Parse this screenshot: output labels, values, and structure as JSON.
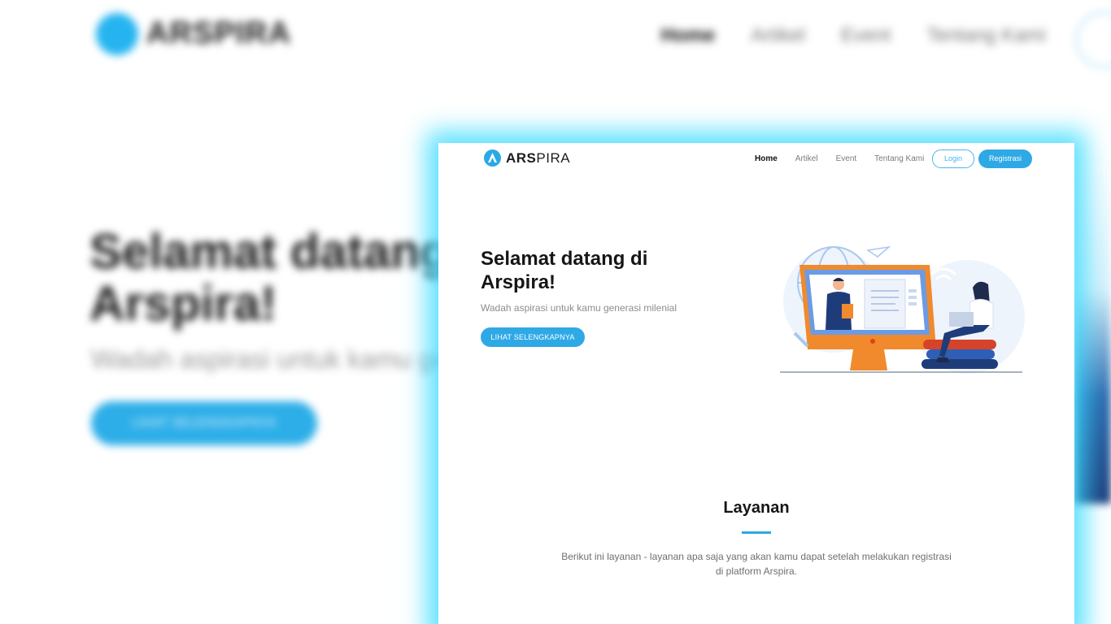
{
  "brand": {
    "name_strong": "ARS",
    "name_rest": "PIRA"
  },
  "nav": {
    "items": [
      {
        "label": "Home",
        "active": true
      },
      {
        "label": "Artikel",
        "active": false
      },
      {
        "label": "Event",
        "active": false
      },
      {
        "label": "Tentang Kami",
        "active": false
      }
    ],
    "login_label": "Login",
    "register_label": "Registrasi"
  },
  "hero": {
    "title": "Selamat datang di Arspira!",
    "subtitle": "Wadah aspirasi untuk kamu generasi milenial",
    "cta_label": "LIHAT SELENGKAPNYA"
  },
  "services": {
    "title": "Layanan",
    "description": "Berikut ini layanan - layanan apa saja yang akan kamu dapat setelah melakukan registrasi di platform Arspira."
  },
  "background": {
    "title": "Selamat datang di Arspira!",
    "subtitle": "Wadah aspirasi untuk kamu generasi milenial"
  },
  "colors": {
    "accent": "#2fa9e6",
    "glow": "#3cdcff",
    "illustration_orange": "#f08a2c",
    "illustration_navy": "#1f3c7a"
  }
}
